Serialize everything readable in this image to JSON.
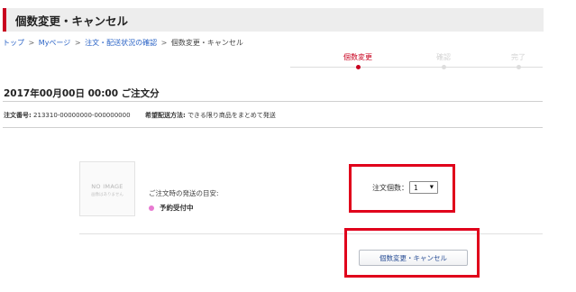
{
  "page": {
    "title": "個数変更・キャンセル"
  },
  "breadcrumb": {
    "items": [
      "トップ",
      "Myページ",
      "注文・配送状況の確認"
    ],
    "separator": ">",
    "current": "個数変更・キャンセル"
  },
  "steps": [
    {
      "label": "個数変更",
      "state": "active"
    },
    {
      "label": "確認",
      "state": "inactive"
    },
    {
      "label": "完了",
      "state": "inactive"
    }
  ],
  "order": {
    "heading": "2017年00月00日 00:00 ご注文分",
    "number_label": "注文番号:",
    "number_value": "213310-00000000-000000000",
    "delivery_label": "希望配送方法:",
    "delivery_value": "できる限り商品をまとめて発送"
  },
  "item": {
    "image_placeholder": "NO IMAGE",
    "image_placeholder_sub": "画像はありません",
    "shipping_estimate_label": "ご注文時の発送の目安:",
    "status": "予約受付中",
    "status_color": "#e87ad1"
  },
  "quantity": {
    "label": "注文個数：",
    "value": "1",
    "options": [
      "1"
    ]
  },
  "actions": {
    "change_cancel_label": "個数変更・キャンセル"
  },
  "colors": {
    "accent": "#c8001e",
    "highlight_box": "#e0001b",
    "link": "#2a63c6"
  }
}
